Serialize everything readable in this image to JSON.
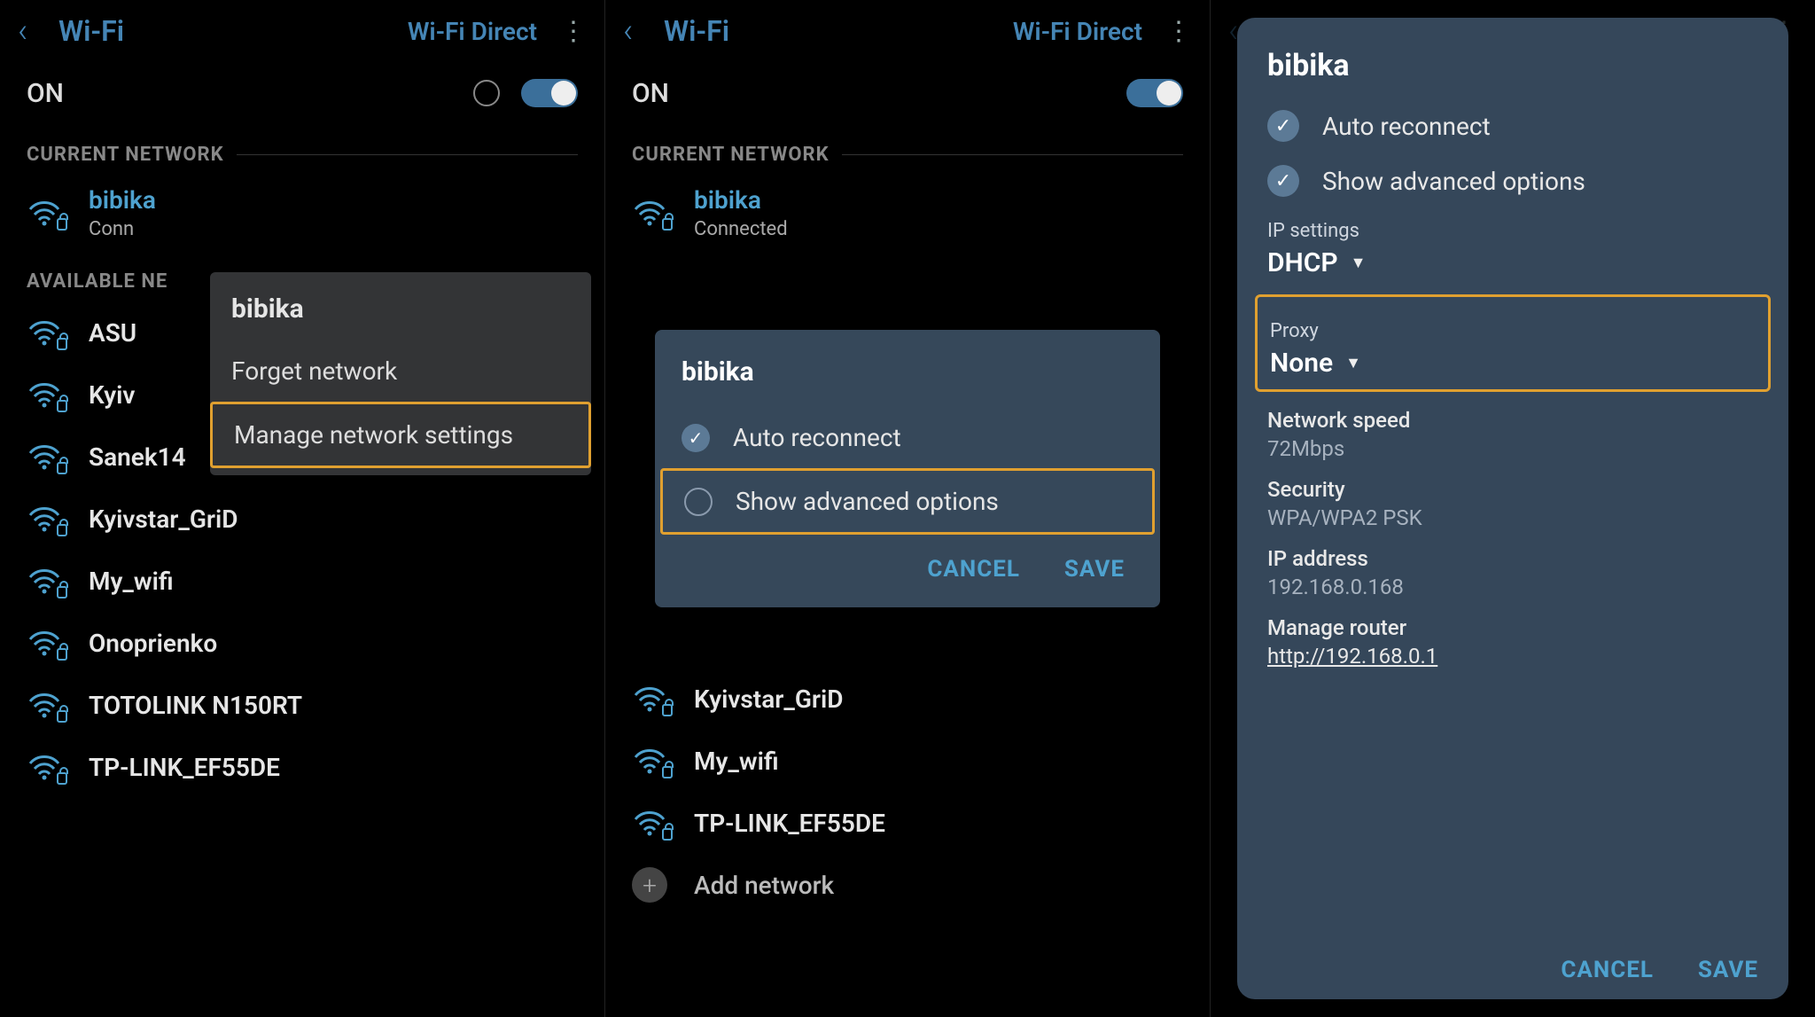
{
  "header": {
    "title": "Wi-Fi",
    "wifi_direct": "Wi-Fi Direct"
  },
  "on_label": "ON",
  "sections": {
    "current": "CURRENT NETWORK",
    "available": "AVAILABLE NETWORKS"
  },
  "current": {
    "ssid": "bibika",
    "status": "Connected",
    "status_trunc": "Conn"
  },
  "networks1": [
    "ASU",
    "Kyiv",
    "Sanek14",
    "Kyivstar_GriD",
    "My_wifi",
    "Onoprienko",
    "TOTOLINK N150RT",
    "TP-LINK_EF55DE"
  ],
  "networks2": [
    "Kyivstar_GriD",
    "My_wifi",
    "TP-LINK_EF55DE"
  ],
  "add_network": "Add network",
  "context": {
    "title": "bibika",
    "forget": "Forget network",
    "manage": "Manage network settings"
  },
  "dialog": {
    "title": "bibika",
    "auto_reconnect": "Auto reconnect",
    "show_advanced": "Show advanced options",
    "cancel": "CANCEL",
    "save": "SAVE"
  },
  "panel": {
    "title": "bibika",
    "auto_reconnect": "Auto reconnect",
    "show_advanced": "Show advanced options",
    "ip_settings_label": "IP settings",
    "ip_settings_value": "DHCP",
    "proxy_label": "Proxy",
    "proxy_value": "None",
    "net_speed_label": "Network speed",
    "net_speed_value": "72Mbps",
    "security_label": "Security",
    "security_value": "WPA/WPA2 PSK",
    "ip_label": "IP address",
    "ip_value": "192.168.0.168",
    "router_label": "Manage router",
    "router_value": "http://192.168.0.1",
    "cancel": "CANCEL",
    "save": "SAVE"
  }
}
